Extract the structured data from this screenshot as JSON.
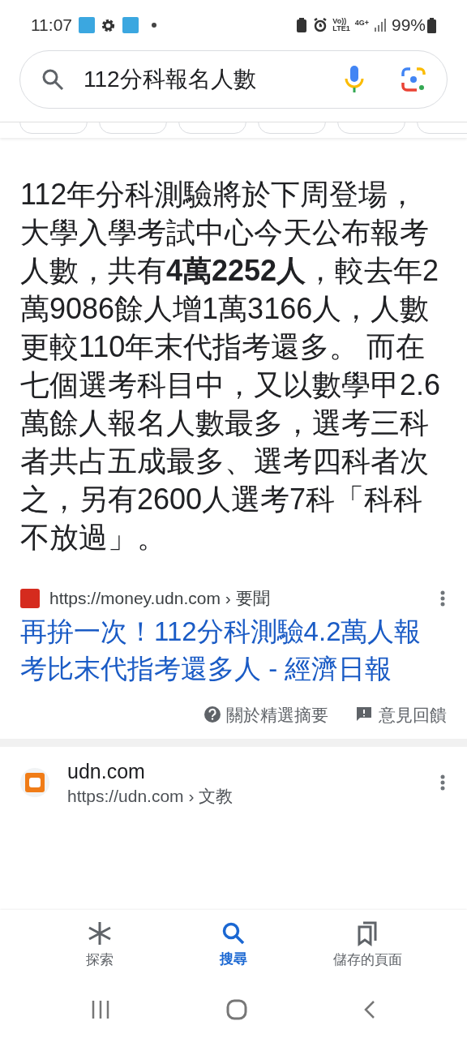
{
  "status_bar": {
    "time": "11:07",
    "network_top": "Vo))",
    "network_bottom": "LTE1",
    "data_type": "4G+",
    "battery": "99%"
  },
  "search": {
    "value": "112分科報名人數"
  },
  "snippet": {
    "text": "112年分科測驗將於下周登場，大學入學考試中心今天公布報考人數，共有**4萬2252人**，較去年2萬9086餘人增1萬3166人，人數更較110年末代指考還多。 而在七個選考科目中，又以數學甲2.6萬餘人報名人數最多，選考三科者共占五成最多、選考四科者次之，另有2600人選考7科「科科不放過」。",
    "source_url": "https://money.udn.com › 要聞",
    "title": "再拚一次！112分科測驗4.2萬人報考比末代指考還多人 - 經濟日報",
    "about": "關於精選摘要",
    "feedback": "意見回饋"
  },
  "result": {
    "site": "udn.com",
    "url": "https://udn.com › 文教"
  },
  "bottom_nav": [
    {
      "label": "探索",
      "selected": false,
      "kind": "discover"
    },
    {
      "label": "搜尋",
      "selected": true,
      "kind": "search"
    },
    {
      "label": "儲存的頁面",
      "selected": false,
      "kind": "saved"
    }
  ]
}
